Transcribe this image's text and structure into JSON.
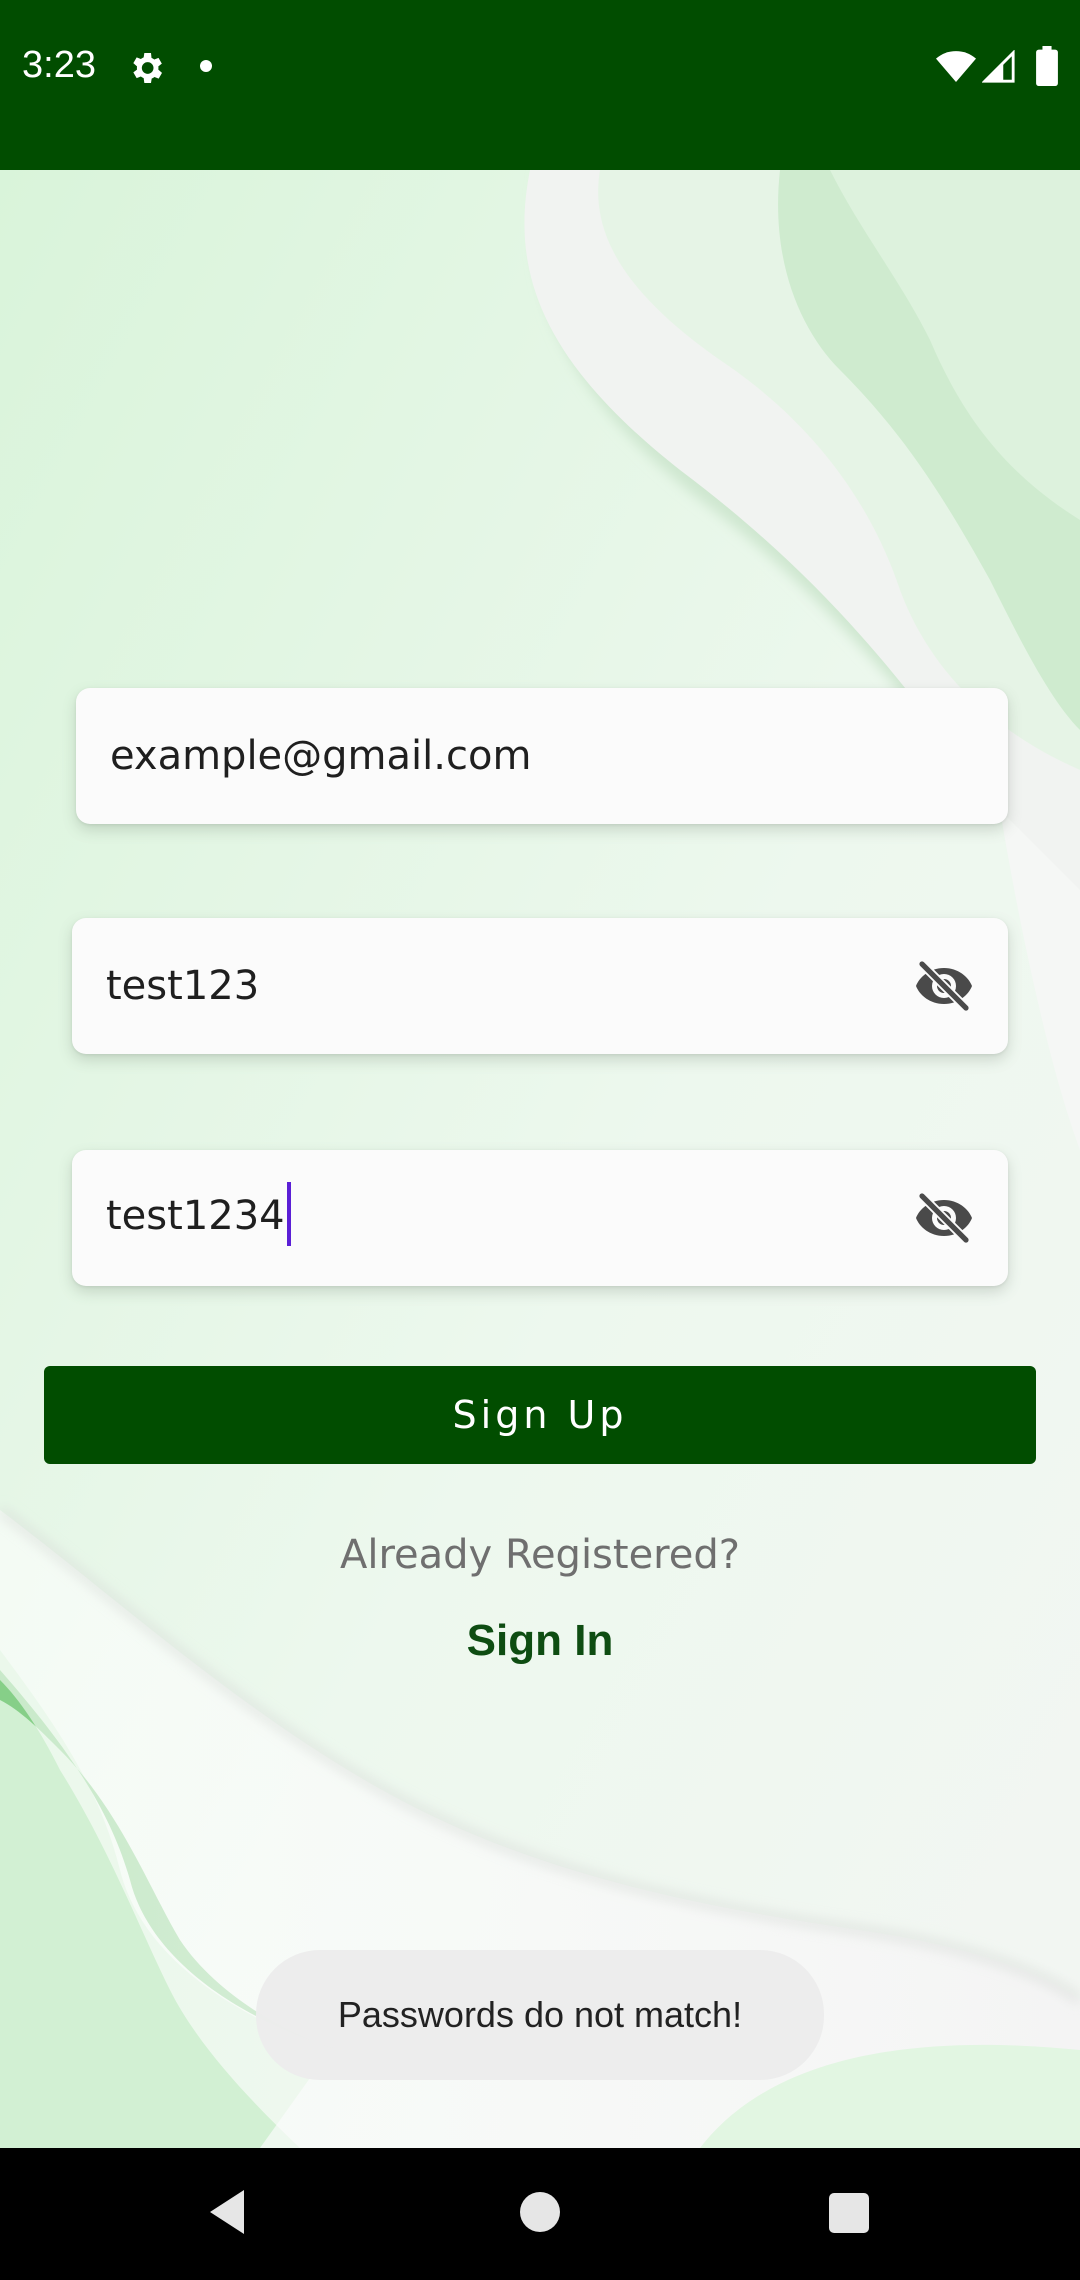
{
  "status_bar": {
    "time": "3:23",
    "icons": [
      "gear-icon",
      "notification-dot-icon",
      "wifi-icon",
      "signal-icon",
      "battery-icon"
    ]
  },
  "form": {
    "email_value": "example@gmail.com",
    "password_value": "test123",
    "confirm_password_value": "test1234",
    "password_visibility_icon": "eye-off-icon",
    "confirm_visibility_icon": "eye-off-icon"
  },
  "actions": {
    "signup_label": "Sign Up",
    "already_registered_text": "Already Registered?",
    "signin_label": "Sign In"
  },
  "toast": {
    "message": "Passwords do not match!"
  },
  "navigation": {
    "icons": [
      "back-icon",
      "home-icon",
      "recents-icon"
    ]
  },
  "colors": {
    "primary": "#014d00",
    "background": "#e3f6e4",
    "accent_caret": "#5b1fd6",
    "link": "#0e4d12"
  }
}
